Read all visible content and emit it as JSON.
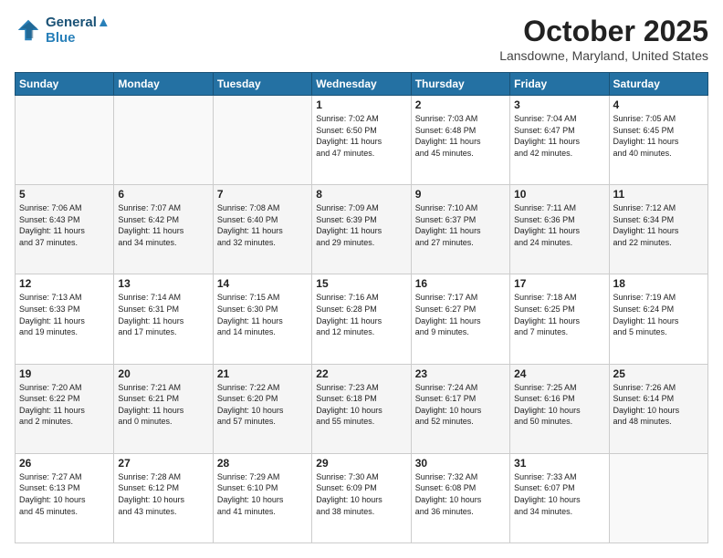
{
  "header": {
    "logo_line1": "General",
    "logo_line2": "Blue",
    "month": "October 2025",
    "location": "Lansdowne, Maryland, United States"
  },
  "weekdays": [
    "Sunday",
    "Monday",
    "Tuesday",
    "Wednesday",
    "Thursday",
    "Friday",
    "Saturday"
  ],
  "weeks": [
    [
      {
        "day": "",
        "info": ""
      },
      {
        "day": "",
        "info": ""
      },
      {
        "day": "",
        "info": ""
      },
      {
        "day": "1",
        "info": "Sunrise: 7:02 AM\nSunset: 6:50 PM\nDaylight: 11 hours\nand 47 minutes."
      },
      {
        "day": "2",
        "info": "Sunrise: 7:03 AM\nSunset: 6:48 PM\nDaylight: 11 hours\nand 45 minutes."
      },
      {
        "day": "3",
        "info": "Sunrise: 7:04 AM\nSunset: 6:47 PM\nDaylight: 11 hours\nand 42 minutes."
      },
      {
        "day": "4",
        "info": "Sunrise: 7:05 AM\nSunset: 6:45 PM\nDaylight: 11 hours\nand 40 minutes."
      }
    ],
    [
      {
        "day": "5",
        "info": "Sunrise: 7:06 AM\nSunset: 6:43 PM\nDaylight: 11 hours\nand 37 minutes."
      },
      {
        "day": "6",
        "info": "Sunrise: 7:07 AM\nSunset: 6:42 PM\nDaylight: 11 hours\nand 34 minutes."
      },
      {
        "day": "7",
        "info": "Sunrise: 7:08 AM\nSunset: 6:40 PM\nDaylight: 11 hours\nand 32 minutes."
      },
      {
        "day": "8",
        "info": "Sunrise: 7:09 AM\nSunset: 6:39 PM\nDaylight: 11 hours\nand 29 minutes."
      },
      {
        "day": "9",
        "info": "Sunrise: 7:10 AM\nSunset: 6:37 PM\nDaylight: 11 hours\nand 27 minutes."
      },
      {
        "day": "10",
        "info": "Sunrise: 7:11 AM\nSunset: 6:36 PM\nDaylight: 11 hours\nand 24 minutes."
      },
      {
        "day": "11",
        "info": "Sunrise: 7:12 AM\nSunset: 6:34 PM\nDaylight: 11 hours\nand 22 minutes."
      }
    ],
    [
      {
        "day": "12",
        "info": "Sunrise: 7:13 AM\nSunset: 6:33 PM\nDaylight: 11 hours\nand 19 minutes."
      },
      {
        "day": "13",
        "info": "Sunrise: 7:14 AM\nSunset: 6:31 PM\nDaylight: 11 hours\nand 17 minutes."
      },
      {
        "day": "14",
        "info": "Sunrise: 7:15 AM\nSunset: 6:30 PM\nDaylight: 11 hours\nand 14 minutes."
      },
      {
        "day": "15",
        "info": "Sunrise: 7:16 AM\nSunset: 6:28 PM\nDaylight: 11 hours\nand 12 minutes."
      },
      {
        "day": "16",
        "info": "Sunrise: 7:17 AM\nSunset: 6:27 PM\nDaylight: 11 hours\nand 9 minutes."
      },
      {
        "day": "17",
        "info": "Sunrise: 7:18 AM\nSunset: 6:25 PM\nDaylight: 11 hours\nand 7 minutes."
      },
      {
        "day": "18",
        "info": "Sunrise: 7:19 AM\nSunset: 6:24 PM\nDaylight: 11 hours\nand 5 minutes."
      }
    ],
    [
      {
        "day": "19",
        "info": "Sunrise: 7:20 AM\nSunset: 6:22 PM\nDaylight: 11 hours\nand 2 minutes."
      },
      {
        "day": "20",
        "info": "Sunrise: 7:21 AM\nSunset: 6:21 PM\nDaylight: 11 hours\nand 0 minutes."
      },
      {
        "day": "21",
        "info": "Sunrise: 7:22 AM\nSunset: 6:20 PM\nDaylight: 10 hours\nand 57 minutes."
      },
      {
        "day": "22",
        "info": "Sunrise: 7:23 AM\nSunset: 6:18 PM\nDaylight: 10 hours\nand 55 minutes."
      },
      {
        "day": "23",
        "info": "Sunrise: 7:24 AM\nSunset: 6:17 PM\nDaylight: 10 hours\nand 52 minutes."
      },
      {
        "day": "24",
        "info": "Sunrise: 7:25 AM\nSunset: 6:16 PM\nDaylight: 10 hours\nand 50 minutes."
      },
      {
        "day": "25",
        "info": "Sunrise: 7:26 AM\nSunset: 6:14 PM\nDaylight: 10 hours\nand 48 minutes."
      }
    ],
    [
      {
        "day": "26",
        "info": "Sunrise: 7:27 AM\nSunset: 6:13 PM\nDaylight: 10 hours\nand 45 minutes."
      },
      {
        "day": "27",
        "info": "Sunrise: 7:28 AM\nSunset: 6:12 PM\nDaylight: 10 hours\nand 43 minutes."
      },
      {
        "day": "28",
        "info": "Sunrise: 7:29 AM\nSunset: 6:10 PM\nDaylight: 10 hours\nand 41 minutes."
      },
      {
        "day": "29",
        "info": "Sunrise: 7:30 AM\nSunset: 6:09 PM\nDaylight: 10 hours\nand 38 minutes."
      },
      {
        "day": "30",
        "info": "Sunrise: 7:32 AM\nSunset: 6:08 PM\nDaylight: 10 hours\nand 36 minutes."
      },
      {
        "day": "31",
        "info": "Sunrise: 7:33 AM\nSunset: 6:07 PM\nDaylight: 10 hours\nand 34 minutes."
      },
      {
        "day": "",
        "info": ""
      }
    ]
  ]
}
